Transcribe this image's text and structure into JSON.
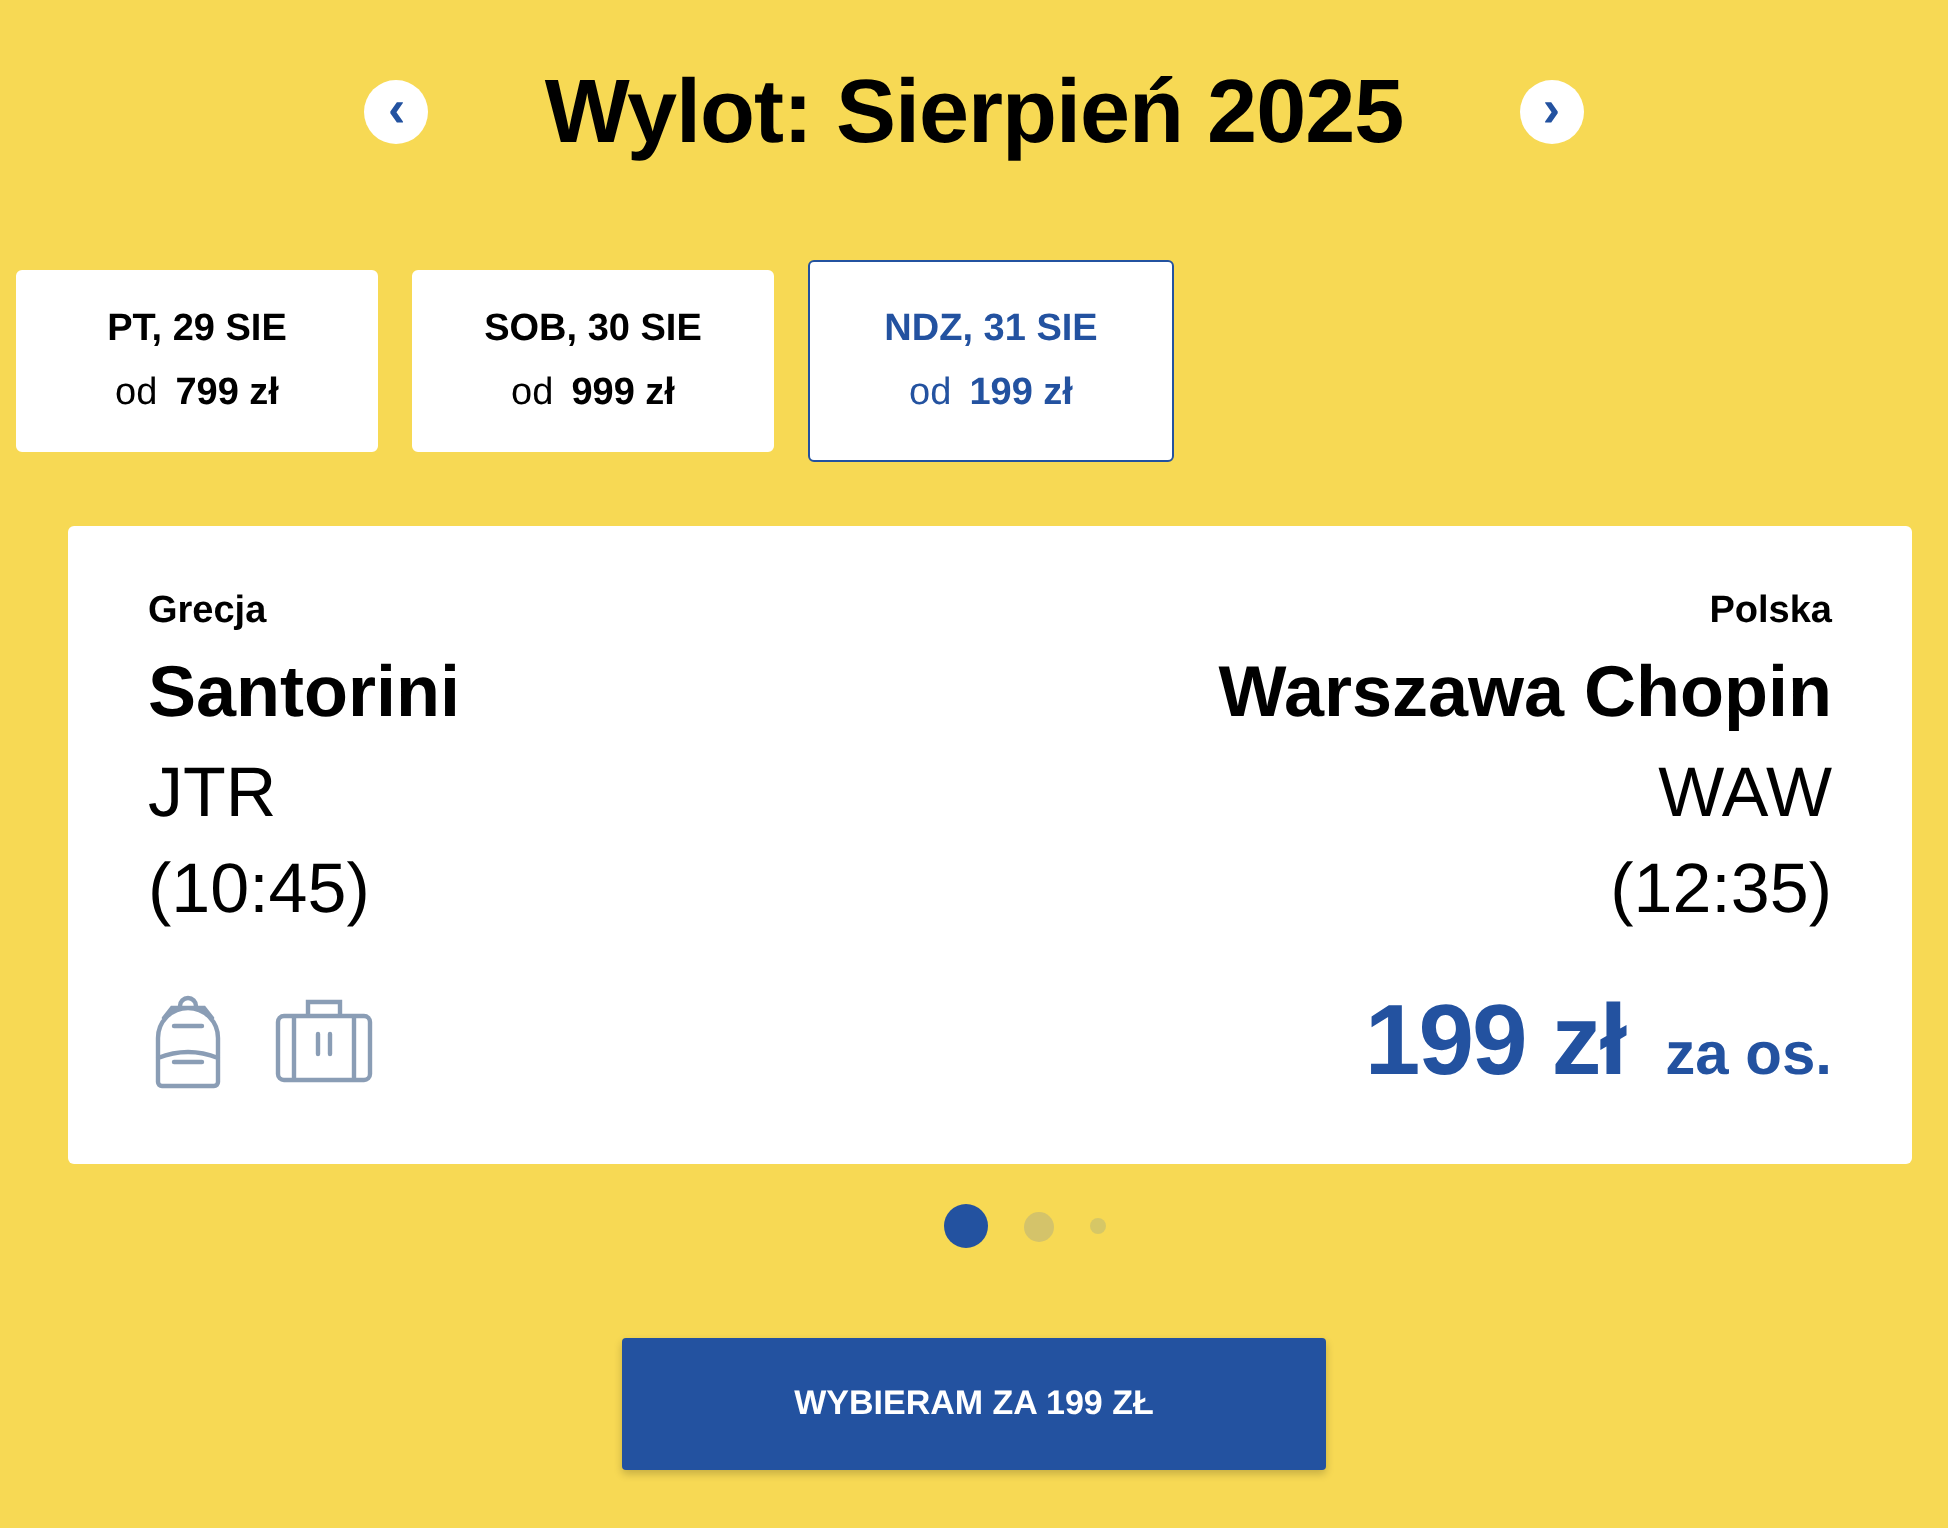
{
  "header": {
    "title": "Wylot: Sierpień 2025",
    "prev": "‹",
    "next": "›"
  },
  "dates": [
    {
      "day": "PT, 29 SIE",
      "from": "od",
      "price": "799 zł",
      "selected": false
    },
    {
      "day": "SOB, 30 SIE",
      "from": "od",
      "price": "999 zł",
      "selected": false
    },
    {
      "day": "NDZ, 31 SIE",
      "from": "od",
      "price": "199 zł",
      "selected": true
    }
  ],
  "flight": {
    "origin": {
      "country": "Grecja",
      "city": "Santorini",
      "code": "JTR",
      "time": "(10:45)"
    },
    "destination": {
      "country": "Polska",
      "city": "Warszawa Chopin",
      "code": "WAW",
      "time": "(12:35)"
    },
    "baggage": [
      {
        "kind": "backpack"
      },
      {
        "kind": "suitcase"
      }
    ],
    "price": "199 zł",
    "per": "za os."
  },
  "pager": [
    {
      "selected": true
    },
    {
      "selected": false
    },
    {
      "selected": false
    }
  ],
  "cta": "WYBIERAM ZA 199 ZŁ"
}
